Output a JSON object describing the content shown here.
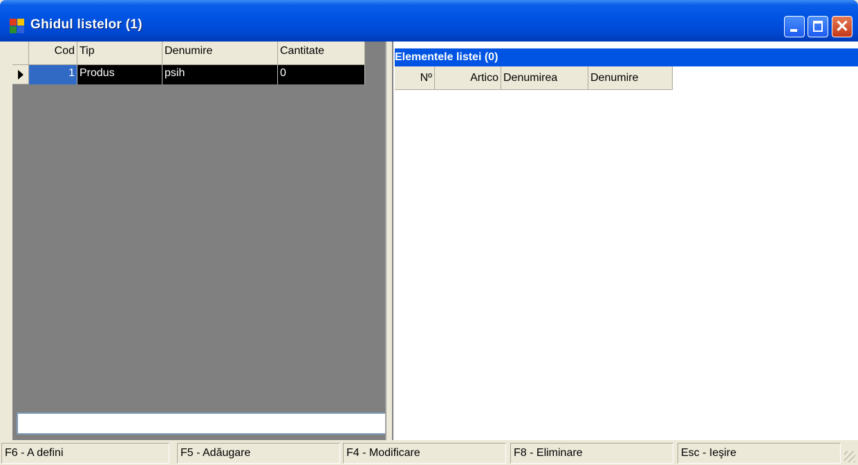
{
  "window": {
    "title": "Ghidul listelor (1)",
    "icon": "app-grid-icon",
    "controls": {
      "minimize": "minimize-icon",
      "maximize": "maximize-icon",
      "close": "✕"
    }
  },
  "left_grid": {
    "columns": [
      "Cod",
      "Tip",
      "Denumire",
      "Cantitate"
    ],
    "rows": [
      {
        "cod": "1",
        "tip": "Produs",
        "denumire": "psih",
        "cantitate": "0"
      }
    ],
    "input_value": ""
  },
  "right_panel": {
    "title": "Elementele listei (0)",
    "columns": [
      "Nº",
      "Artico",
      "Denumirea",
      "Denumire"
    ]
  },
  "statusbar": {
    "items": [
      "F6 - A defini",
      "F5 - Adăugare",
      "F4 - Modificare",
      "F8 - Eliminare",
      "Esc - Ieşire"
    ]
  },
  "colors": {
    "titlebar": "#0054e3",
    "selection": "#316ac5",
    "grid_background": "#808080",
    "panel_header": "#0054e3"
  }
}
